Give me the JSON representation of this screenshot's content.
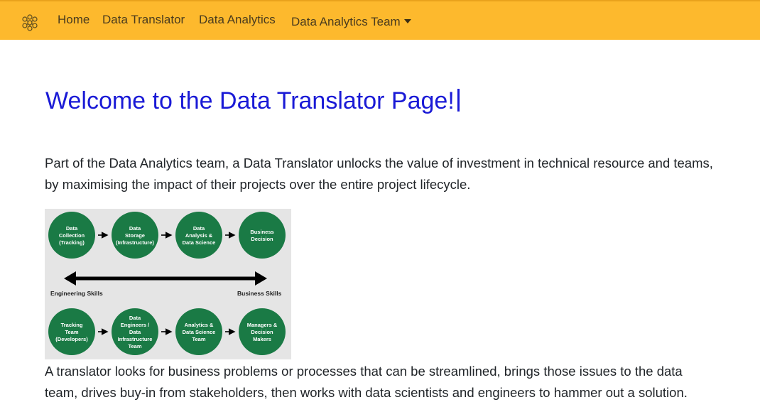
{
  "nav": {
    "brand_icon": "network-molecule-icon",
    "items": [
      {
        "label": "Home"
      },
      {
        "label": "Data Translator"
      },
      {
        "label": "Data Analytics"
      },
      {
        "label": "Data Analytics Team"
      }
    ],
    "background": "#fdb92d"
  },
  "main": {
    "title": "Welcome to the Data Translator Page!",
    "title_color": "#1a1ad6",
    "paragraph1_line1": "Part of the Data Analytics team, a Data Translator unlocks the value of investment in technical resource and teams,",
    "paragraph1_line2": "by maximising the impact of their projects over the entire project lifecycle.",
    "paragraph2_line1": "A translator looks for business problems or processes that can be streamlined, brings those issues to the data",
    "paragraph2_line2": "team, drives buy-in from stakeholders, then works with data scientists and engineers to hammer out a solution."
  },
  "diagram": {
    "top_row": [
      [
        "Data",
        "Collection",
        "(Tracking)"
      ],
      [
        "Data",
        "Storage",
        "(Infrastructure)"
      ],
      [
        "Data",
        "Analysis &",
        "Data Science"
      ],
      [
        "Business",
        "Decision"
      ]
    ],
    "left_label": "Engineering Skills",
    "right_label": "Business Skills",
    "bottom_row": [
      [
        "Tracking",
        "Team",
        "(Developers)"
      ],
      [
        "Data",
        "Engineers /",
        "Data",
        "Infrastructure",
        "Team"
      ],
      [
        "Analytics &",
        "Data Science",
        "Team"
      ],
      [
        "Managers &",
        "Decision",
        "Makers"
      ]
    ],
    "circle_color": "#1a7a45"
  }
}
